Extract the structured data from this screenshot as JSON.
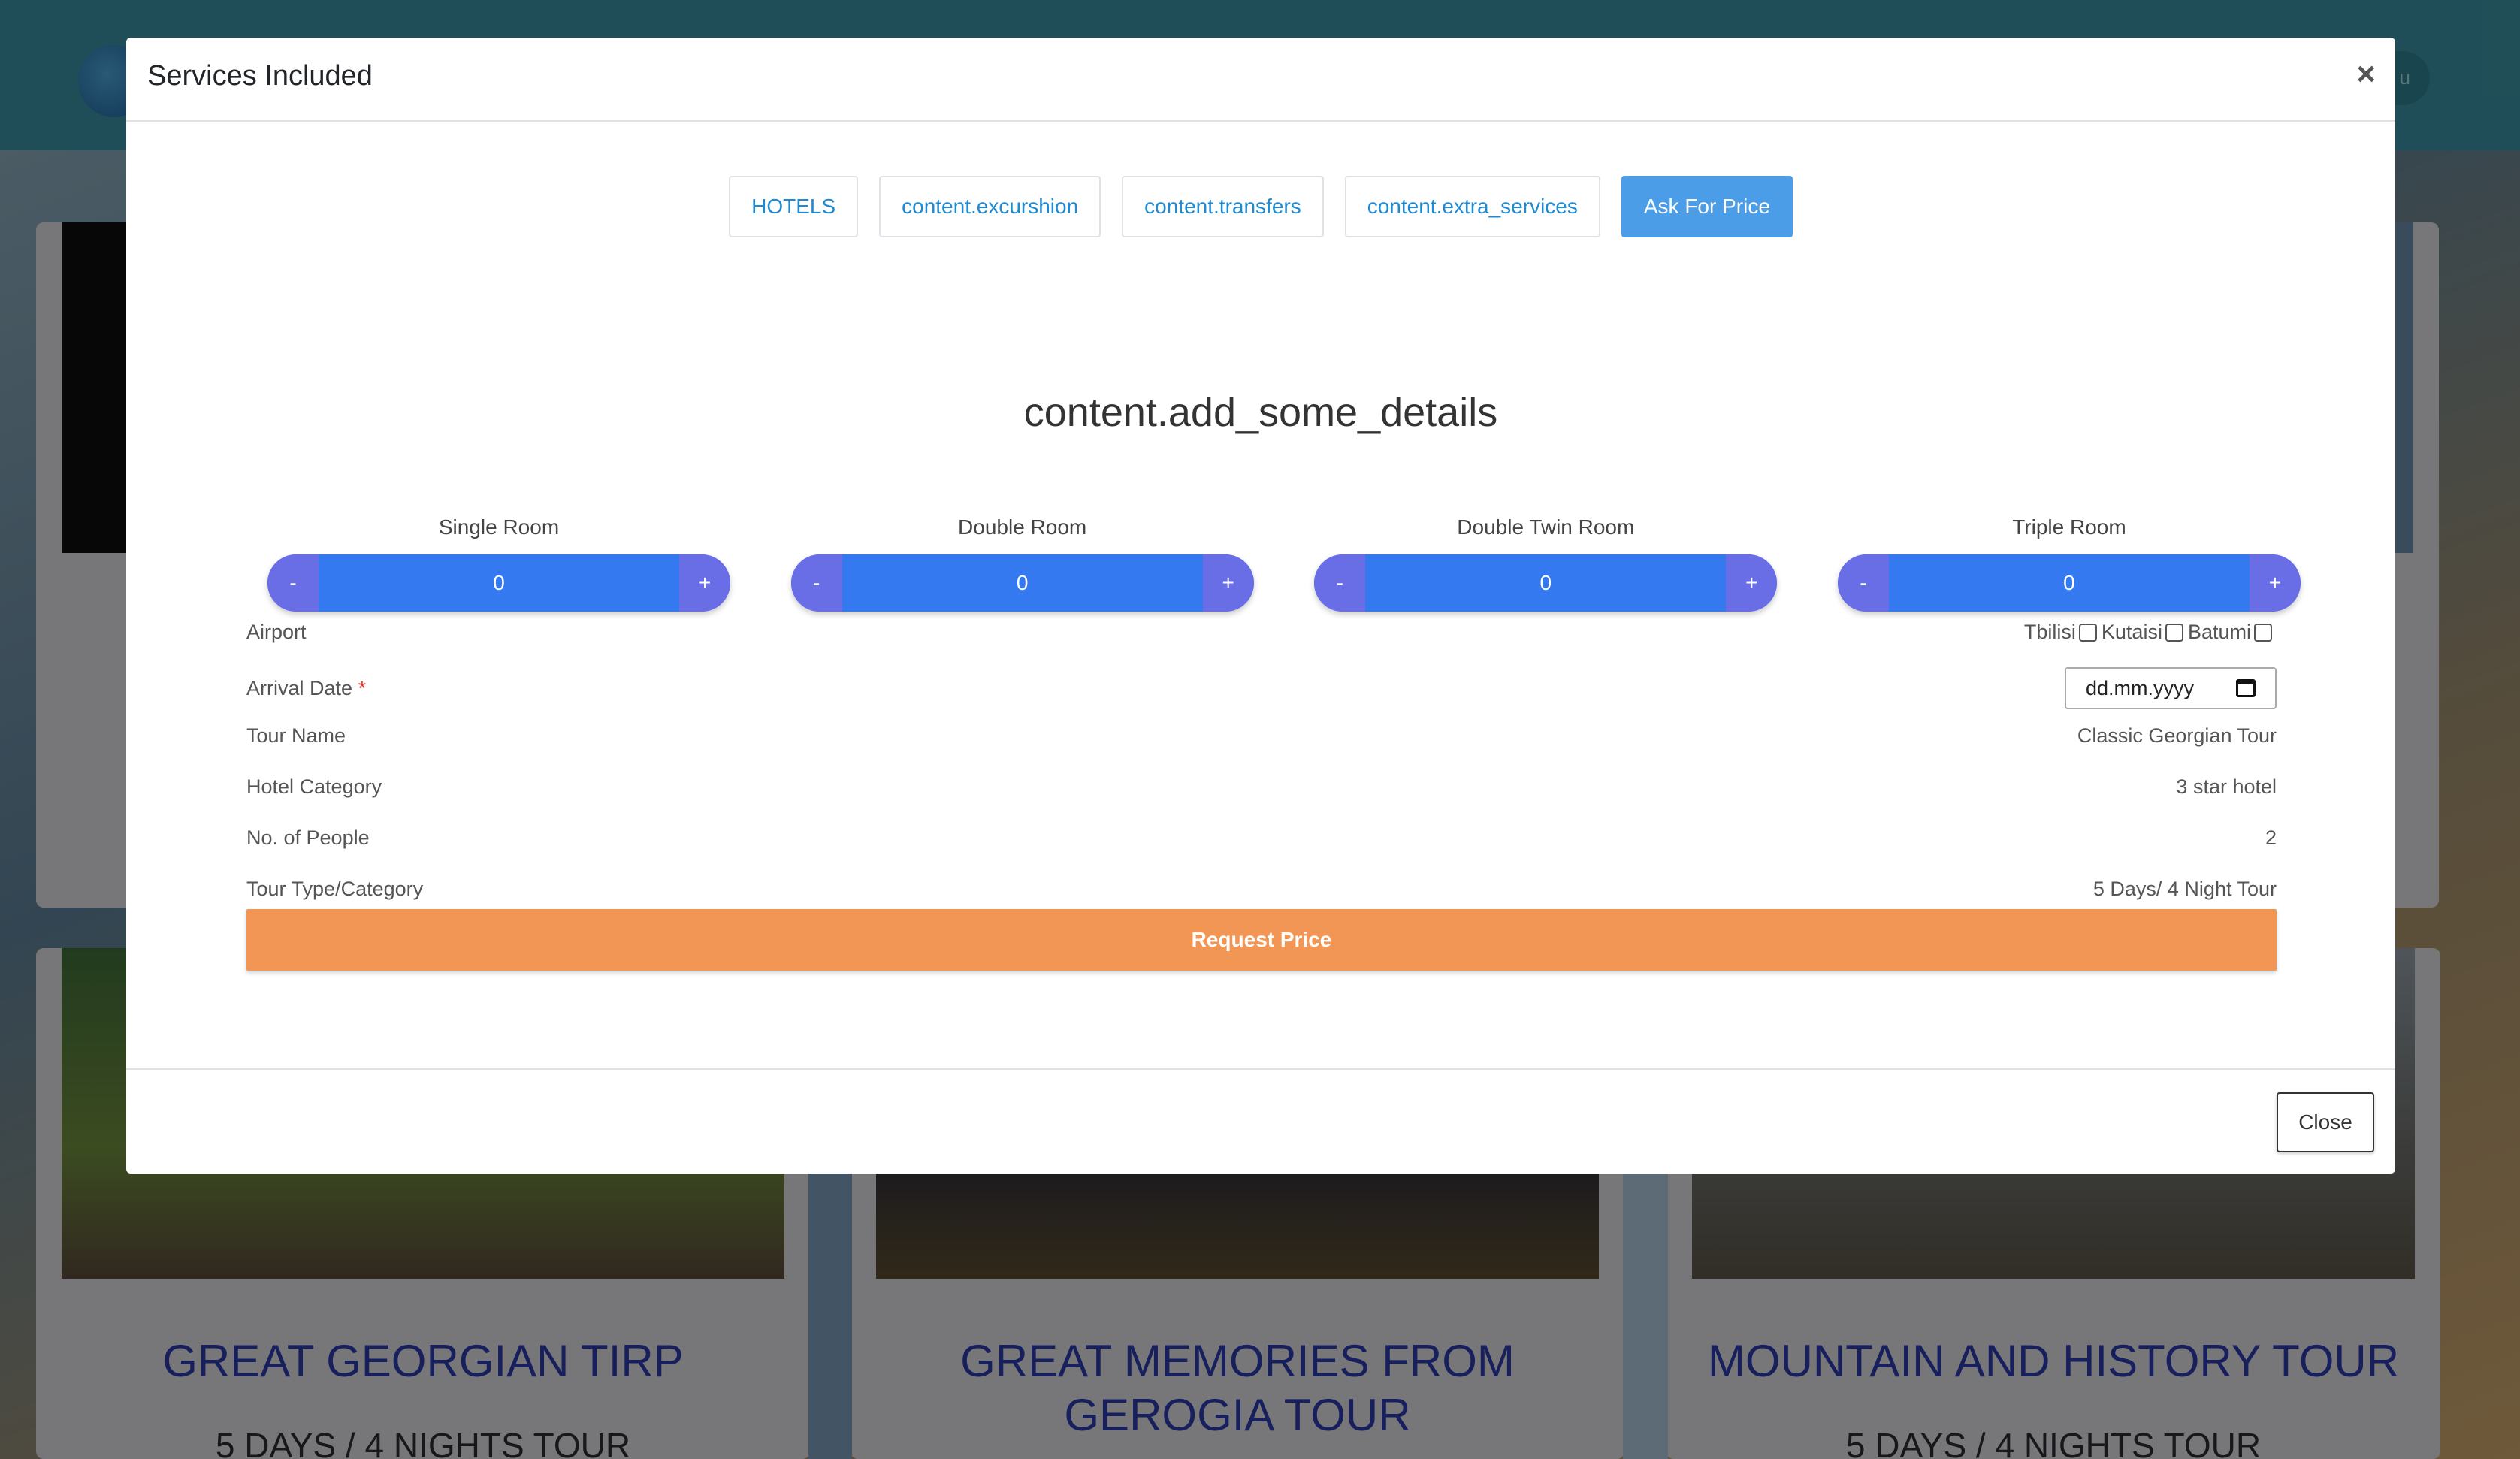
{
  "background": {
    "menu_label": "u",
    "cards": [
      {
        "title": "GREAT GEORGIAN TIRP",
        "subtitle": "5 DAYS / 4 NIGHTS TOUR"
      },
      {
        "title": "GREAT MEMORIES FROM GEROGIA TOUR",
        "subtitle": ""
      },
      {
        "title": "MOUNTAIN AND HISTORY TOUR",
        "subtitle": "5 DAYS / 4 NIGHTS TOUR"
      }
    ]
  },
  "modal": {
    "title": "Services Included",
    "close_x": "×",
    "tabs": [
      {
        "label": "HOTELS",
        "active": false
      },
      {
        "label": "content.excurshion",
        "active": false
      },
      {
        "label": "content.transfers",
        "active": false
      },
      {
        "label": "content.extra_services",
        "active": false
      },
      {
        "label": "Ask For Price",
        "active": true
      }
    ],
    "heading": "content.add_some_details",
    "rooms": [
      {
        "label": "Single Room",
        "value": "0",
        "minus": "-",
        "plus": "+"
      },
      {
        "label": "Double Room",
        "value": "0",
        "minus": "-",
        "plus": "+"
      },
      {
        "label": "Double Twin Room",
        "value": "0",
        "minus": "-",
        "plus": "+"
      },
      {
        "label": "Triple Room",
        "value": "0",
        "minus": "-",
        "plus": "+"
      }
    ],
    "airport": {
      "label": "Airport",
      "options": [
        "Tbilisi",
        "Kutaisi",
        "Batumi"
      ]
    },
    "arrival": {
      "label": "Arrival Date",
      "required_mark": "*",
      "placeholder": "dd.mm.yyyy"
    },
    "fields": [
      {
        "label": "Tour Name",
        "value": "Classic Georgian Tour"
      },
      {
        "label": "Hotel Category",
        "value": "3 star hotel"
      },
      {
        "label": "No. of People",
        "value": "2"
      },
      {
        "label": "Tour Type/Category",
        "value": "5 Days/ 4 Night Tour"
      }
    ],
    "request_button": "Request Price",
    "footer_close": "Close"
  }
}
